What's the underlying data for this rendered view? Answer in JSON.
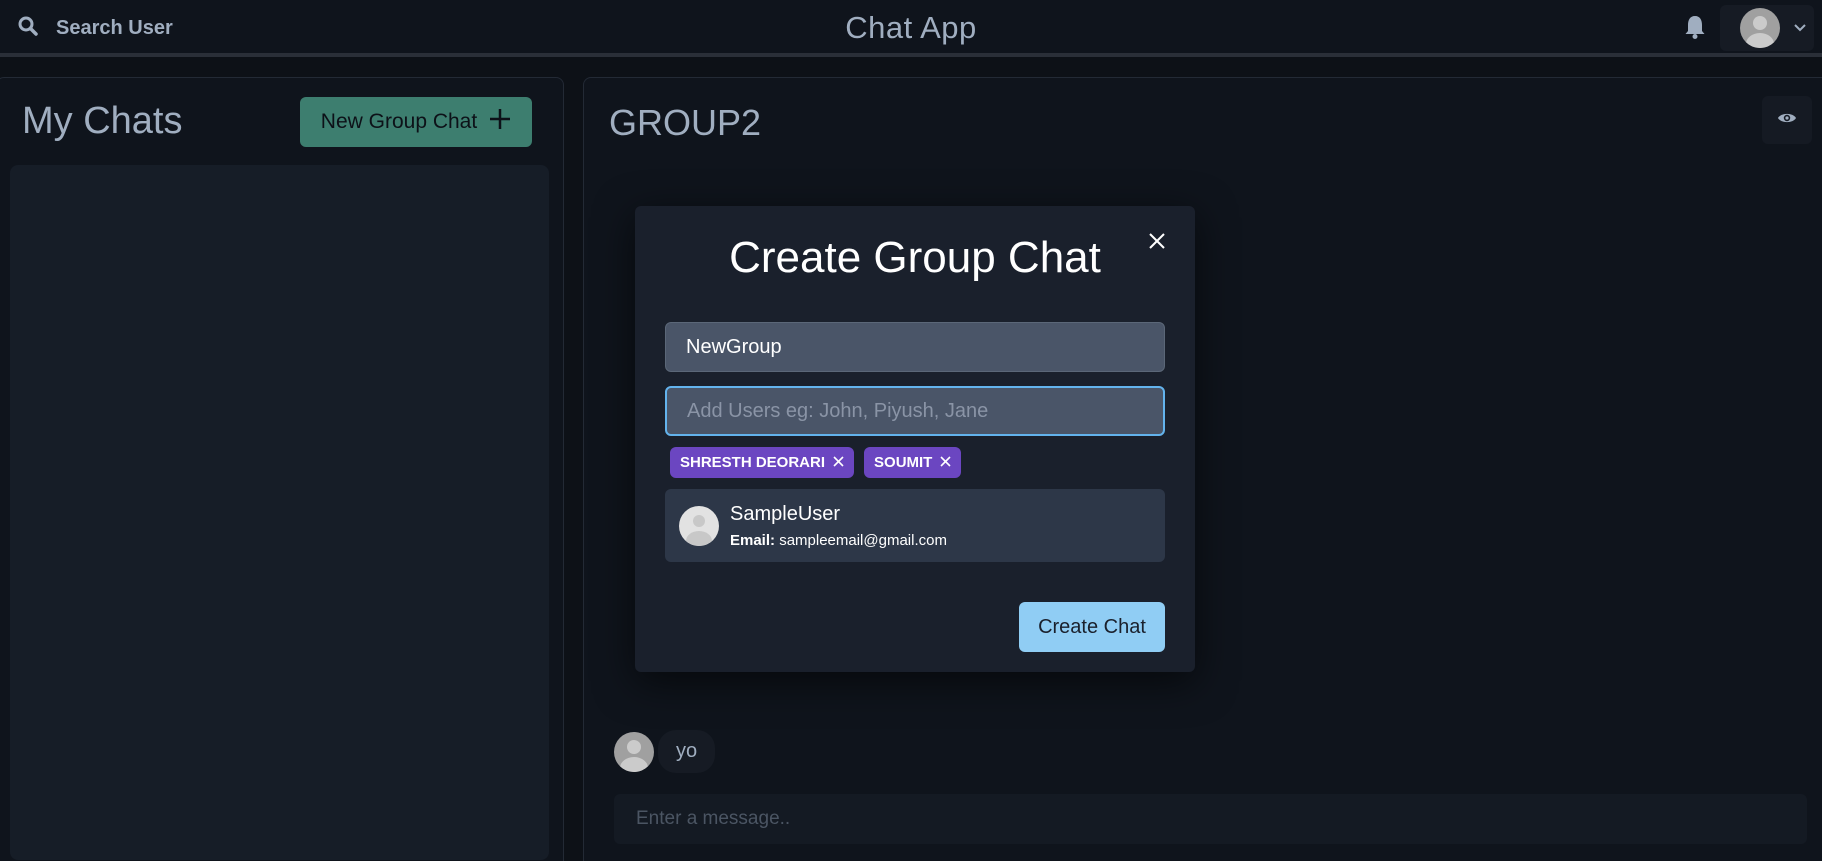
{
  "header": {
    "search_label": "Search User",
    "app_title": "Chat App",
    "icons": {
      "search": "search-icon",
      "bell": "bell-icon",
      "profile": "avatar",
      "chevron": "chevron-down-icon"
    }
  },
  "sidebar": {
    "title": "My Chats",
    "new_group_label": "New Group Chat"
  },
  "chat": {
    "name": "GROUP2",
    "messages": [
      {
        "text": "yo"
      }
    ],
    "input_placeholder": "Enter a message.."
  },
  "modal": {
    "title": "Create Group Chat",
    "group_name_value": "NewGroup",
    "add_users_placeholder": "Add Users eg: John, Piyush, Jane",
    "selected_users": [
      {
        "label": "SHRESTH DEORARI"
      },
      {
        "label": "SOUMIT"
      }
    ],
    "search_results": [
      {
        "name": "SampleUser",
        "email_label": "Email:",
        "email": "sampleemail@gmail.com"
      }
    ],
    "create_label": "Create Chat"
  },
  "colors": {
    "background": "#0d1117",
    "accent_teal": "#4fa78f",
    "tag_purple": "#6b46c1",
    "button_blue": "#90cdf4",
    "focus_border": "#63b3ed"
  }
}
